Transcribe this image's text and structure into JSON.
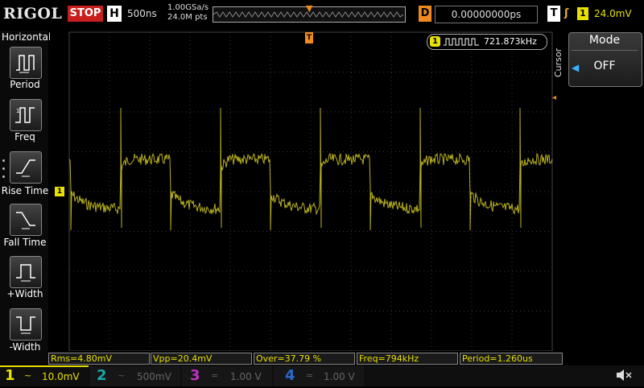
{
  "app": {
    "brand": "RIGOL",
    "run_status": "STOP"
  },
  "horizontal_status": {
    "label": "H",
    "timebase": "500ns",
    "sample_rate": "1.00GSa/s",
    "memory_depth": "24.0M pts"
  },
  "delay": {
    "label": "D",
    "value": "0.00000000ps"
  },
  "trigger": {
    "label": "T",
    "edge_icon": "rising-edge-icon",
    "source": "1",
    "level": "24.0mV"
  },
  "left_menu": {
    "title": "Horizontal",
    "items": [
      {
        "label": "Period",
        "icon": "period-icon"
      },
      {
        "label": "Freq",
        "icon": "frequency-icon"
      },
      {
        "label": "Rise Time",
        "icon": "rise-time-icon"
      },
      {
        "label": "Fall Time",
        "icon": "fall-time-icon"
      },
      {
        "label": "+Width",
        "icon": "positive-width-icon"
      },
      {
        "label": "-Width",
        "icon": "negative-width-icon"
      }
    ]
  },
  "freq_counter": {
    "channel": "1",
    "value": "721.873kHz"
  },
  "ch1_marker": "1",
  "right_panel": {
    "side_label": "Cursor",
    "mode_title": "Mode",
    "mode_value": "OFF"
  },
  "measurements": [
    "Rms=4.80mV",
    "Vpp=20.4mV",
    "Over=37.79 %",
    "Freq=794kHz",
    "Period=1.260us"
  ],
  "channels": [
    {
      "num": "1",
      "coupling": "~",
      "scale": "10.0mV",
      "color": "#e8e000",
      "active": true
    },
    {
      "num": "2",
      "coupling": "~",
      "scale": "500mV",
      "color": "#1aa8a8",
      "active": false
    },
    {
      "num": "3",
      "coupling": "=",
      "scale": "1.00 V",
      "color": "#c030c0",
      "active": false
    },
    {
      "num": "4",
      "coupling": "=",
      "scale": "1.00 V",
      "color": "#2a6acc",
      "active": false
    }
  ],
  "colors": {
    "ch1": "#e8e000",
    "trigger": "#f08a1e",
    "stop": "#c81e1e",
    "grid": "#3a3a3a"
  }
}
